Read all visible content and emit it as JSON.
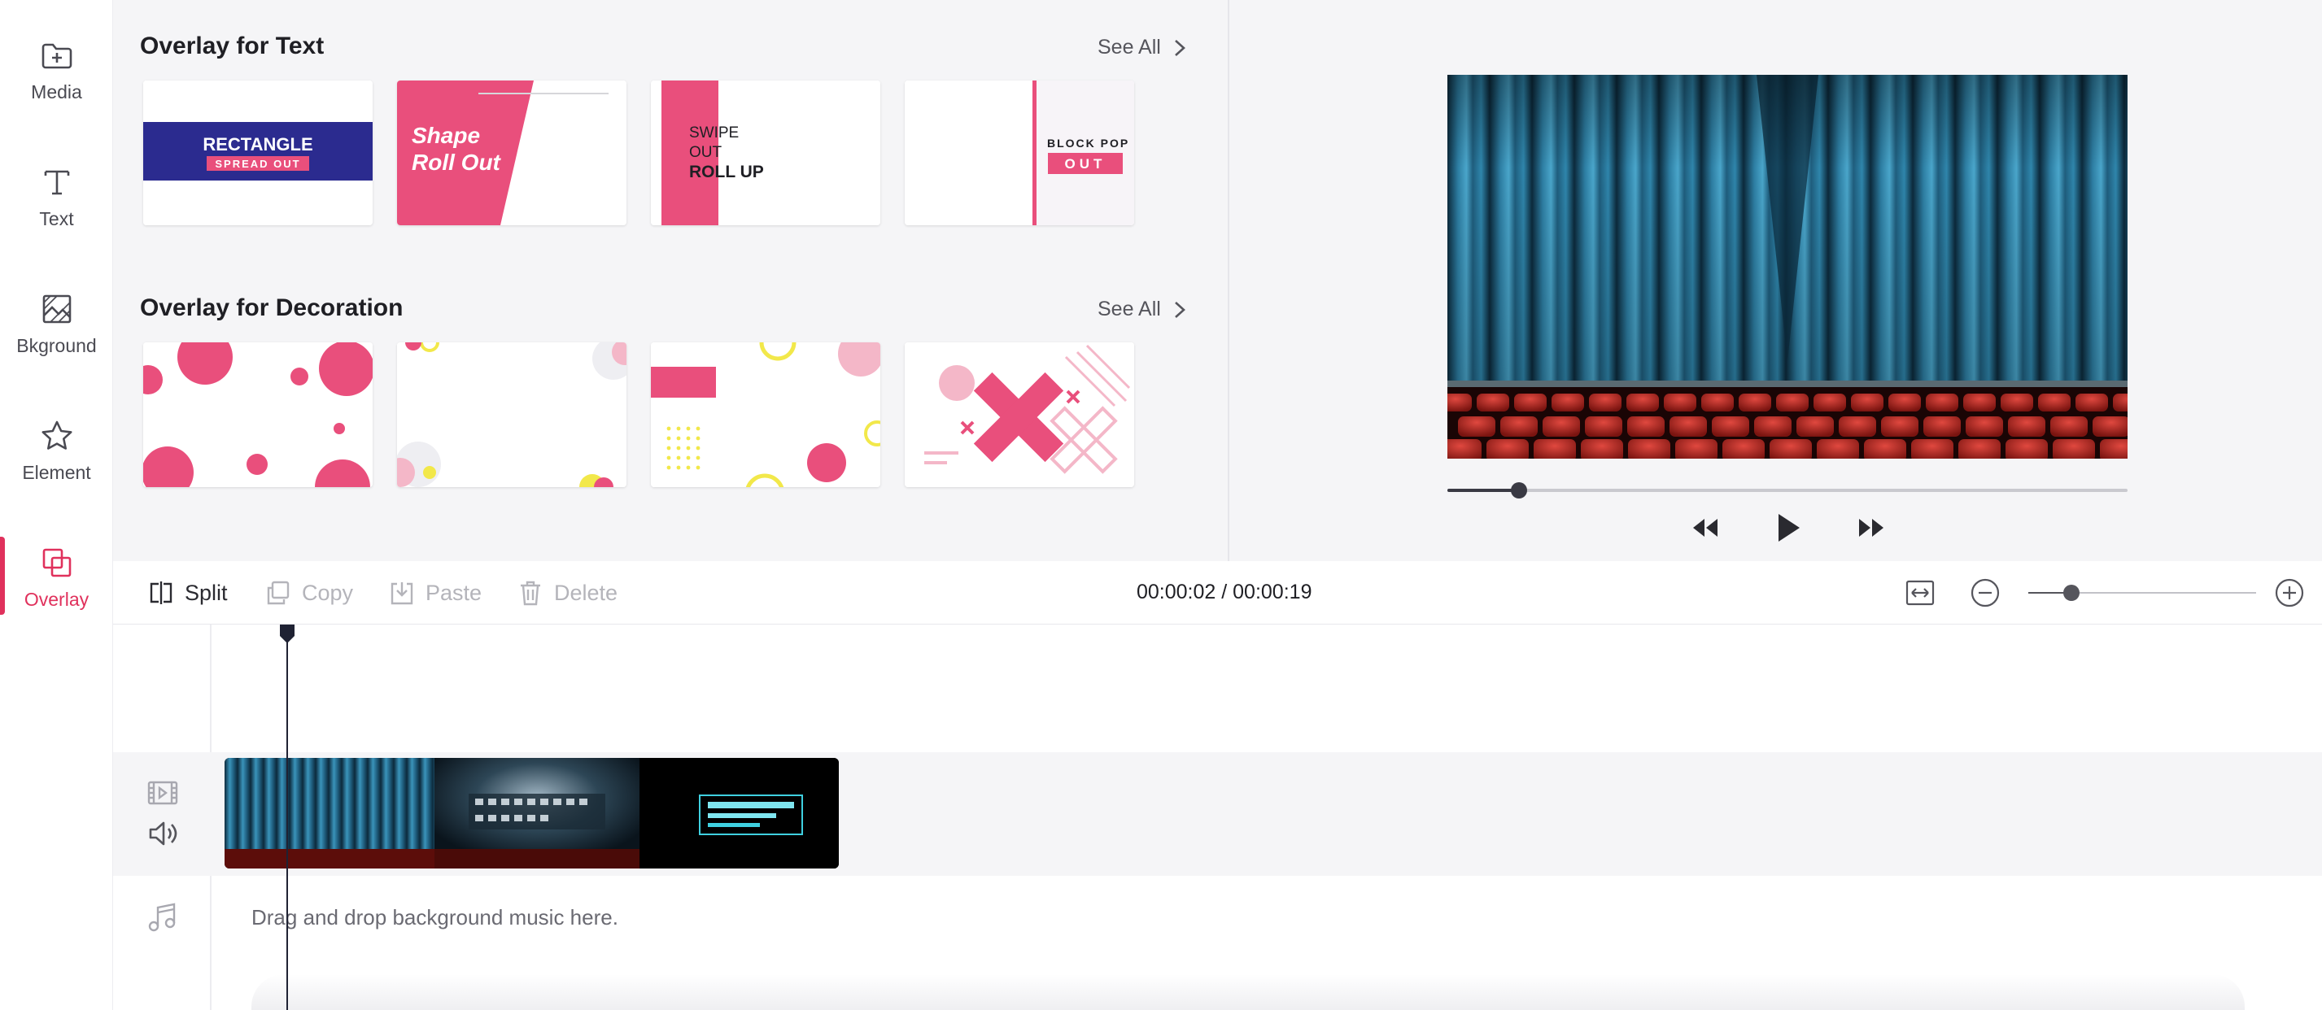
{
  "sidebar": {
    "items": [
      {
        "label": "Media",
        "icon": "folder-plus-icon",
        "active": false
      },
      {
        "label": "Text",
        "icon": "text-icon",
        "active": false
      },
      {
        "label": "Bkground",
        "icon": "background-icon",
        "active": false
      },
      {
        "label": "Element",
        "icon": "star-icon",
        "active": false
      },
      {
        "label": "Overlay",
        "icon": "overlay-icon",
        "active": true
      }
    ]
  },
  "library": {
    "text_section": {
      "title": "Overlay for Text",
      "see_all": "See All",
      "thumbs": [
        {
          "name": "rectangle-spread-out",
          "line1": "RECTANGLE",
          "line2": "SPREAD OUT"
        },
        {
          "name": "shape-roll-out",
          "line1": "Shape",
          "line2": "Roll Out"
        },
        {
          "name": "swipe-out-roll-up",
          "line1": "SWIPE",
          "line2": "OUT",
          "line3": "ROLL UP"
        },
        {
          "name": "block-pop-out",
          "line1": "BLOCK POP",
          "line2": "OUT"
        }
      ]
    },
    "decoration_section": {
      "title": "Overlay for Decoration",
      "see_all": "See All"
    }
  },
  "player": {
    "progress": 0.105
  },
  "toolbar": {
    "split": "Split",
    "copy": "Copy",
    "paste": "Paste",
    "delete": "Delete",
    "timecode": "00:00:02 / 00:00:19",
    "zoom_level": 0.19
  },
  "timeline": {
    "music_placeholder": "Drag and drop background music here."
  },
  "colors": {
    "accent": "#e0315c",
    "overlay_pink": "#e94f7c",
    "rect_purple": "#2b2b8f",
    "decoration_yellow": "#f2e84a"
  }
}
